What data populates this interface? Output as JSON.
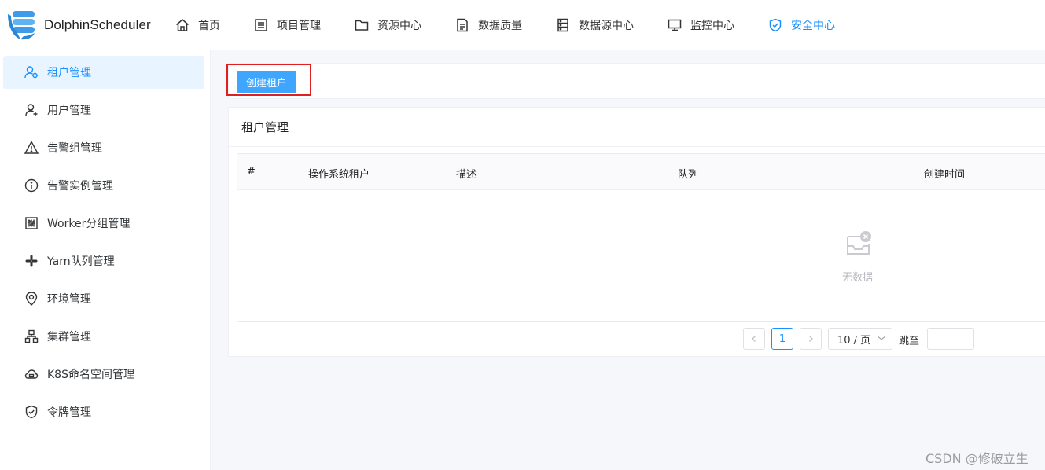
{
  "app": {
    "name": "DolphinScheduler"
  },
  "header": {
    "nav": [
      {
        "label": "首页",
        "icon": "home-icon"
      },
      {
        "label": "项目管理",
        "icon": "project-list-icon"
      },
      {
        "label": "资源中心",
        "icon": "folder-icon"
      },
      {
        "label": "数据质量",
        "icon": "document-icon"
      },
      {
        "label": "数据源中心",
        "icon": "database-icon"
      },
      {
        "label": "监控中心",
        "icon": "monitor-icon"
      },
      {
        "label": "安全中心",
        "icon": "shield-check-icon",
        "active": true
      }
    ]
  },
  "sidebar": {
    "items": [
      {
        "label": "租户管理",
        "icon": "tenant-icon",
        "active": true
      },
      {
        "label": "用户管理",
        "icon": "user-add-icon"
      },
      {
        "label": "告警组管理",
        "icon": "warning-icon"
      },
      {
        "label": "告警实例管理",
        "icon": "info-circle-icon"
      },
      {
        "label": "Worker分组管理",
        "icon": "slider-box-icon"
      },
      {
        "label": "Yarn队列管理",
        "icon": "slack-icon"
      },
      {
        "label": "环境管理",
        "icon": "location-icon"
      },
      {
        "label": "集群管理",
        "icon": "cluster-icon"
      },
      {
        "label": "K8S命名空间管理",
        "icon": "cloud-icon"
      },
      {
        "label": "令牌管理",
        "icon": "shield-token-icon"
      }
    ]
  },
  "toolbar": {
    "create_label": "创建租户"
  },
  "card": {
    "title": "租户管理"
  },
  "table": {
    "columns": [
      "#",
      "操作系统租户",
      "描述",
      "队列",
      "创建时间"
    ],
    "rows": [],
    "empty_text": "无数据"
  },
  "pagination": {
    "current_page": "1",
    "page_size_label": "10 / 页",
    "jump_label": "跳至",
    "jump_value": ""
  },
  "watermark": "CSDN @修破立生",
  "colors": {
    "accent": "#1890ff",
    "button": "#3ea6ff",
    "highlight_frame": "#e02020"
  }
}
